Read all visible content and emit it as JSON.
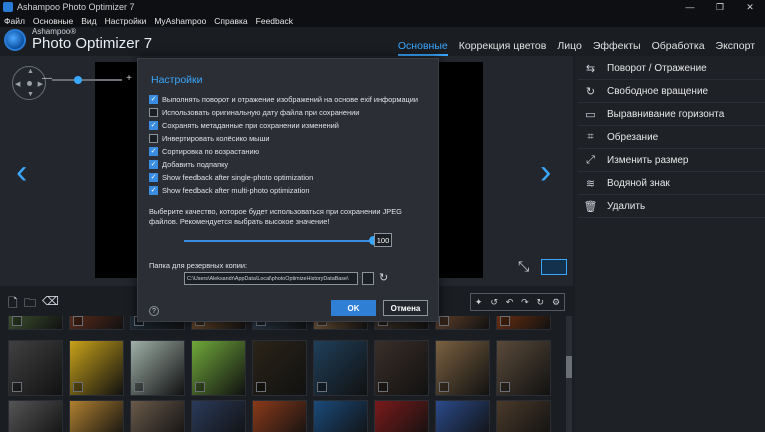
{
  "window": {
    "title": "Ashampoo Photo Optimizer 7",
    "controls": [
      "—",
      "❐",
      "✕"
    ]
  },
  "menu": [
    "Файл",
    "Основные",
    "Вид",
    "Настройки",
    "MyAshampoo",
    "Справка",
    "Feedback"
  ],
  "brand": {
    "sub": "Ashampoo®",
    "main": "Photo Optimizer 7"
  },
  "tabs": [
    {
      "label": "Основные",
      "active": true
    },
    {
      "label": "Коррекция цветов",
      "active": false
    },
    {
      "label": "Лицо",
      "active": false
    },
    {
      "label": "Эффекты",
      "active": false
    },
    {
      "label": "Обработка",
      "active": false
    },
    {
      "label": "Экспорт",
      "active": false
    }
  ],
  "zoom": {
    "minus": "—",
    "plus": "+"
  },
  "tools": [
    {
      "label": "Поворот / Отражение",
      "icon": "rotate-flip-icon",
      "glyph": "⇆"
    },
    {
      "label": "Свободное вращение",
      "icon": "free-rotate-icon",
      "glyph": "↻"
    },
    {
      "label": "Выравнивание горизонта",
      "icon": "horizon-icon",
      "glyph": "▭"
    },
    {
      "label": "Обрезание",
      "icon": "crop-icon",
      "glyph": "⌗"
    },
    {
      "label": "Изменить размер",
      "icon": "resize-icon",
      "glyph": "⤢"
    },
    {
      "label": "Водяной знак",
      "icon": "watermark-icon",
      "glyph": "≋"
    },
    {
      "label": "Удалить",
      "icon": "trash-icon",
      "glyph": "🗑"
    }
  ],
  "settings": {
    "title": "Настройки",
    "options": [
      {
        "label": "Выполнять поворот и отражение изображений на основе exif информации",
        "checked": true
      },
      {
        "label": "Использовать оригинальную дату файла при сохранении",
        "checked": false
      },
      {
        "label": "Сохранять метаданные при сохранении изменений",
        "checked": true
      },
      {
        "label": "Инвертировать колёсико мыши",
        "checked": false
      },
      {
        "label": "Сортировка по возрастанию",
        "checked": true
      },
      {
        "label": "Добавить подпапку",
        "checked": true
      },
      {
        "label": "Show feedback after single-photo optimization",
        "checked": true
      },
      {
        "label": "Show feedback after multi-photo optimization",
        "checked": true
      }
    ],
    "jpeg_text": "Выберите качество, которое будет использоваться при сохранении JPEG файлов. Рекомендуется выбрать высокое значение!",
    "jpeg_quality": 100,
    "jpeg_quality_text": "100",
    "backup_label": "Папка для резервных копии:",
    "backup_path": "C:\\Users\\Aleksandr\\AppData\\Local\\photoOptimizeHistoryDataBase\\",
    "ok_label": "OK",
    "cancel_label": "Отмена",
    "help_glyph": "?"
  },
  "thumb_colors": [
    [
      "#3b4f2e",
      "#5a2a1a",
      "#1f2d3a",
      "#6b4a2a",
      "#2c3c4f",
      "#7a5b3a",
      "#413328",
      "#5e3f2a",
      "#6a2f10"
    ],
    [
      "#404040",
      "#c8a21a",
      "#9fb0a8",
      "#6fa83a",
      "#2a2418",
      "#1f3f5a",
      "#3a2e28",
      "#7a6040",
      "#5a4a3a"
    ],
    [
      "#555",
      "#b08030",
      "#6a5a4a",
      "#2a3a5a",
      "#8a3a1a",
      "#1a4a7a",
      "#7a1a1a",
      "#2a4a8a",
      "#4a3a2a"
    ]
  ]
}
